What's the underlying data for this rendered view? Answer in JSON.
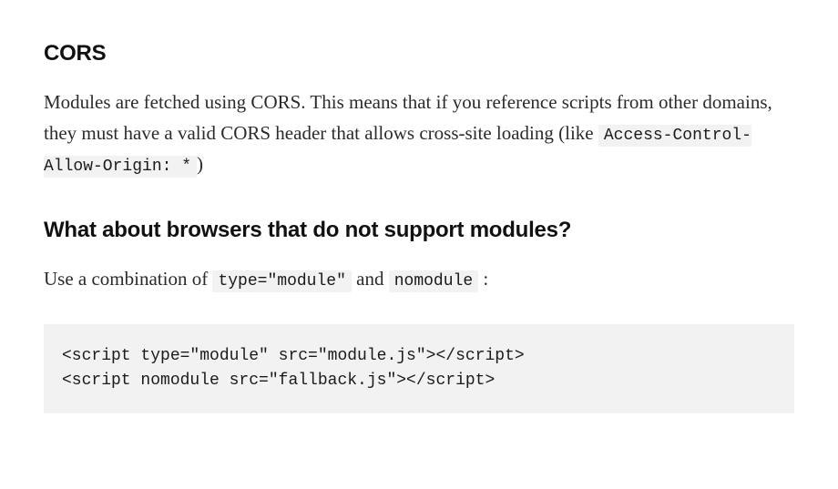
{
  "sections": {
    "cors": {
      "heading": "CORS",
      "para_part1": "Modules are fetched using CORS. This means that if you reference scripts from other domains, they must have a valid CORS header that allows cross-site loading (like ",
      "code_inline": "Access-Control-Allow-Origin: *",
      "para_part2": ")"
    },
    "nomodule": {
      "heading": "What about browsers that do not support modules?",
      "para_part1": "Use a combination of ",
      "code_inline1": "type=\"module\"",
      "para_part2": " and ",
      "code_inline2": "nomodule",
      "para_part3": " :",
      "codeblock": "<script type=\"module\" src=\"module.js\"></script>\n<script nomodule src=\"fallback.js\"></script>"
    }
  }
}
